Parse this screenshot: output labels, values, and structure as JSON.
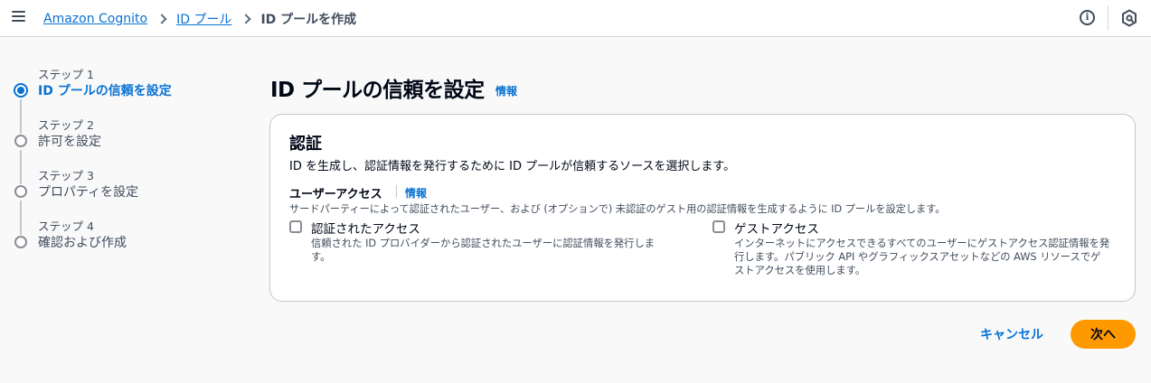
{
  "breadcrumbs": {
    "items": [
      "Amazon Cognito",
      "ID プール"
    ],
    "current": "ID プールを作成"
  },
  "topbar": {
    "info_icon": "info-icon",
    "settings_icon": "settings-icon",
    "menu_icon": "menu-icon"
  },
  "steps": [
    {
      "number": "ステップ 1",
      "title": "ID プールの信頼を設定",
      "active": true
    },
    {
      "number": "ステップ 2",
      "title": "許可を設定",
      "active": false
    },
    {
      "number": "ステップ 3",
      "title": "プロパティを設定",
      "active": false
    },
    {
      "number": "ステップ 4",
      "title": "確認および作成",
      "active": false
    }
  ],
  "page": {
    "title": "ID プールの信頼を設定",
    "info": "情報"
  },
  "auth": {
    "title": "認証",
    "description": "ID を生成し、認証情報を発行するために ID プールが信頼するソースを選択します。",
    "field_label": "ユーザーアクセス",
    "field_info": "情報",
    "field_description": "サードパーティーによって認証されたユーザー、および (オプションで) 未認証のゲスト用の認証情報を生成するように ID プールを設定します。",
    "options": [
      {
        "label": "認証されたアクセス",
        "description": "信頼された ID プロバイダーから認証されたユーザーに認証情報を発行します。",
        "checked": false
      },
      {
        "label": "ゲストアクセス",
        "description": "インターネットにアクセスできるすべてのユーザーにゲストアクセス認証情報を発行します。パブリック API やグラフィックスアセットなどの AWS リソースでゲストアクセスを使用します。",
        "checked": false
      }
    ]
  },
  "actions": {
    "cancel": "キャンセル",
    "next": "次へ"
  },
  "colors": {
    "accent": "#0972d3",
    "primary_button": "#ff9900"
  }
}
